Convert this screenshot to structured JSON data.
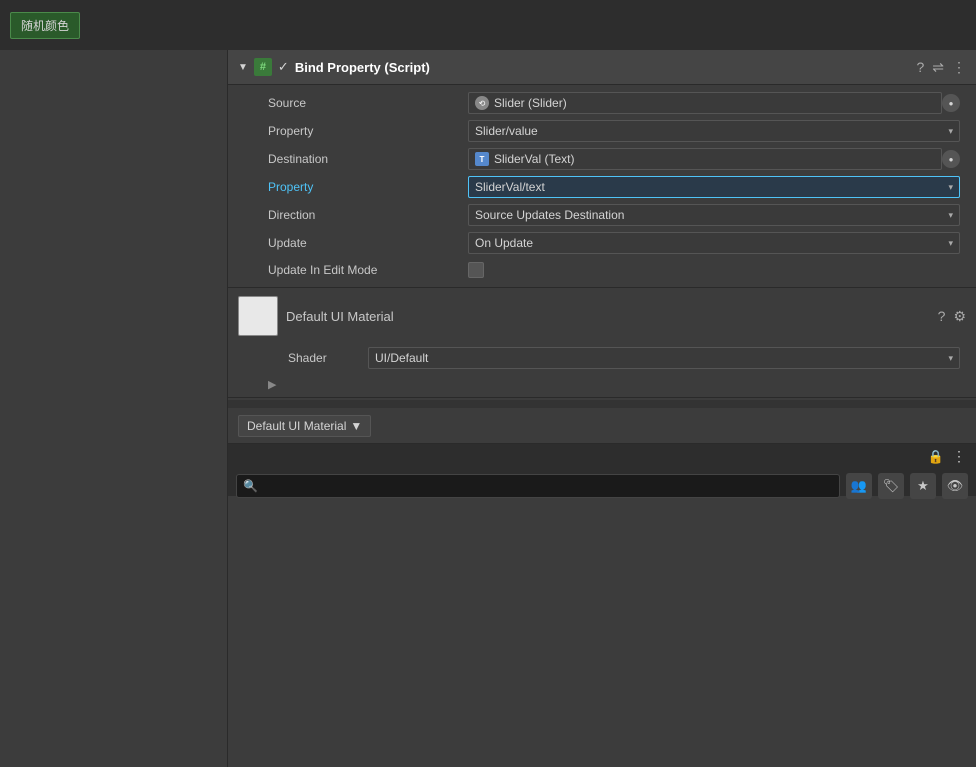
{
  "topBar": {
    "randomColorBtn": "随机颜色"
  },
  "component": {
    "title": "Bind Property (Script)",
    "checkmark": "✓",
    "collapseArrow": "▼",
    "hashLabel": "#",
    "fields": {
      "sourceLabel": "Source",
      "sourceValue": "Slider (Slider)",
      "propertyLabel1": "Property",
      "propertyValue1": "Slider/value",
      "destinationLabel": "Destination",
      "destinationValue": "SliderVal (Text)",
      "destinationIconLabel": "T",
      "propertyLabel2": "Property",
      "propertyValue2": "SliderVal/text",
      "directionLabel": "Direction",
      "directionValue": "Source Updates Destination",
      "updateLabel": "Update",
      "updateValue": "On Update",
      "updateEditLabel": "Update In Edit Mode"
    }
  },
  "material": {
    "title": "Default UI Material",
    "shaderLabel": "Shader",
    "shaderValue": "UI/Default"
  },
  "bottomToolbar": {
    "materialBtn": "Default UI Material",
    "dropdownArrow": "▼"
  },
  "bottomPanel": {
    "lockIcon": "🔒",
    "moreIcon": "⋮",
    "searchPlaceholder": "",
    "searchIconChar": "🔍",
    "peopleIcon": "👥",
    "tagIcon": "🏷",
    "starIcon": "★",
    "eyeIcon": "👁"
  },
  "icons": {
    "questionMark": "?",
    "sliders": "⇌",
    "ellipsis": "⋮",
    "dropdownArrow": "▾",
    "circleTarget": "⊙"
  }
}
